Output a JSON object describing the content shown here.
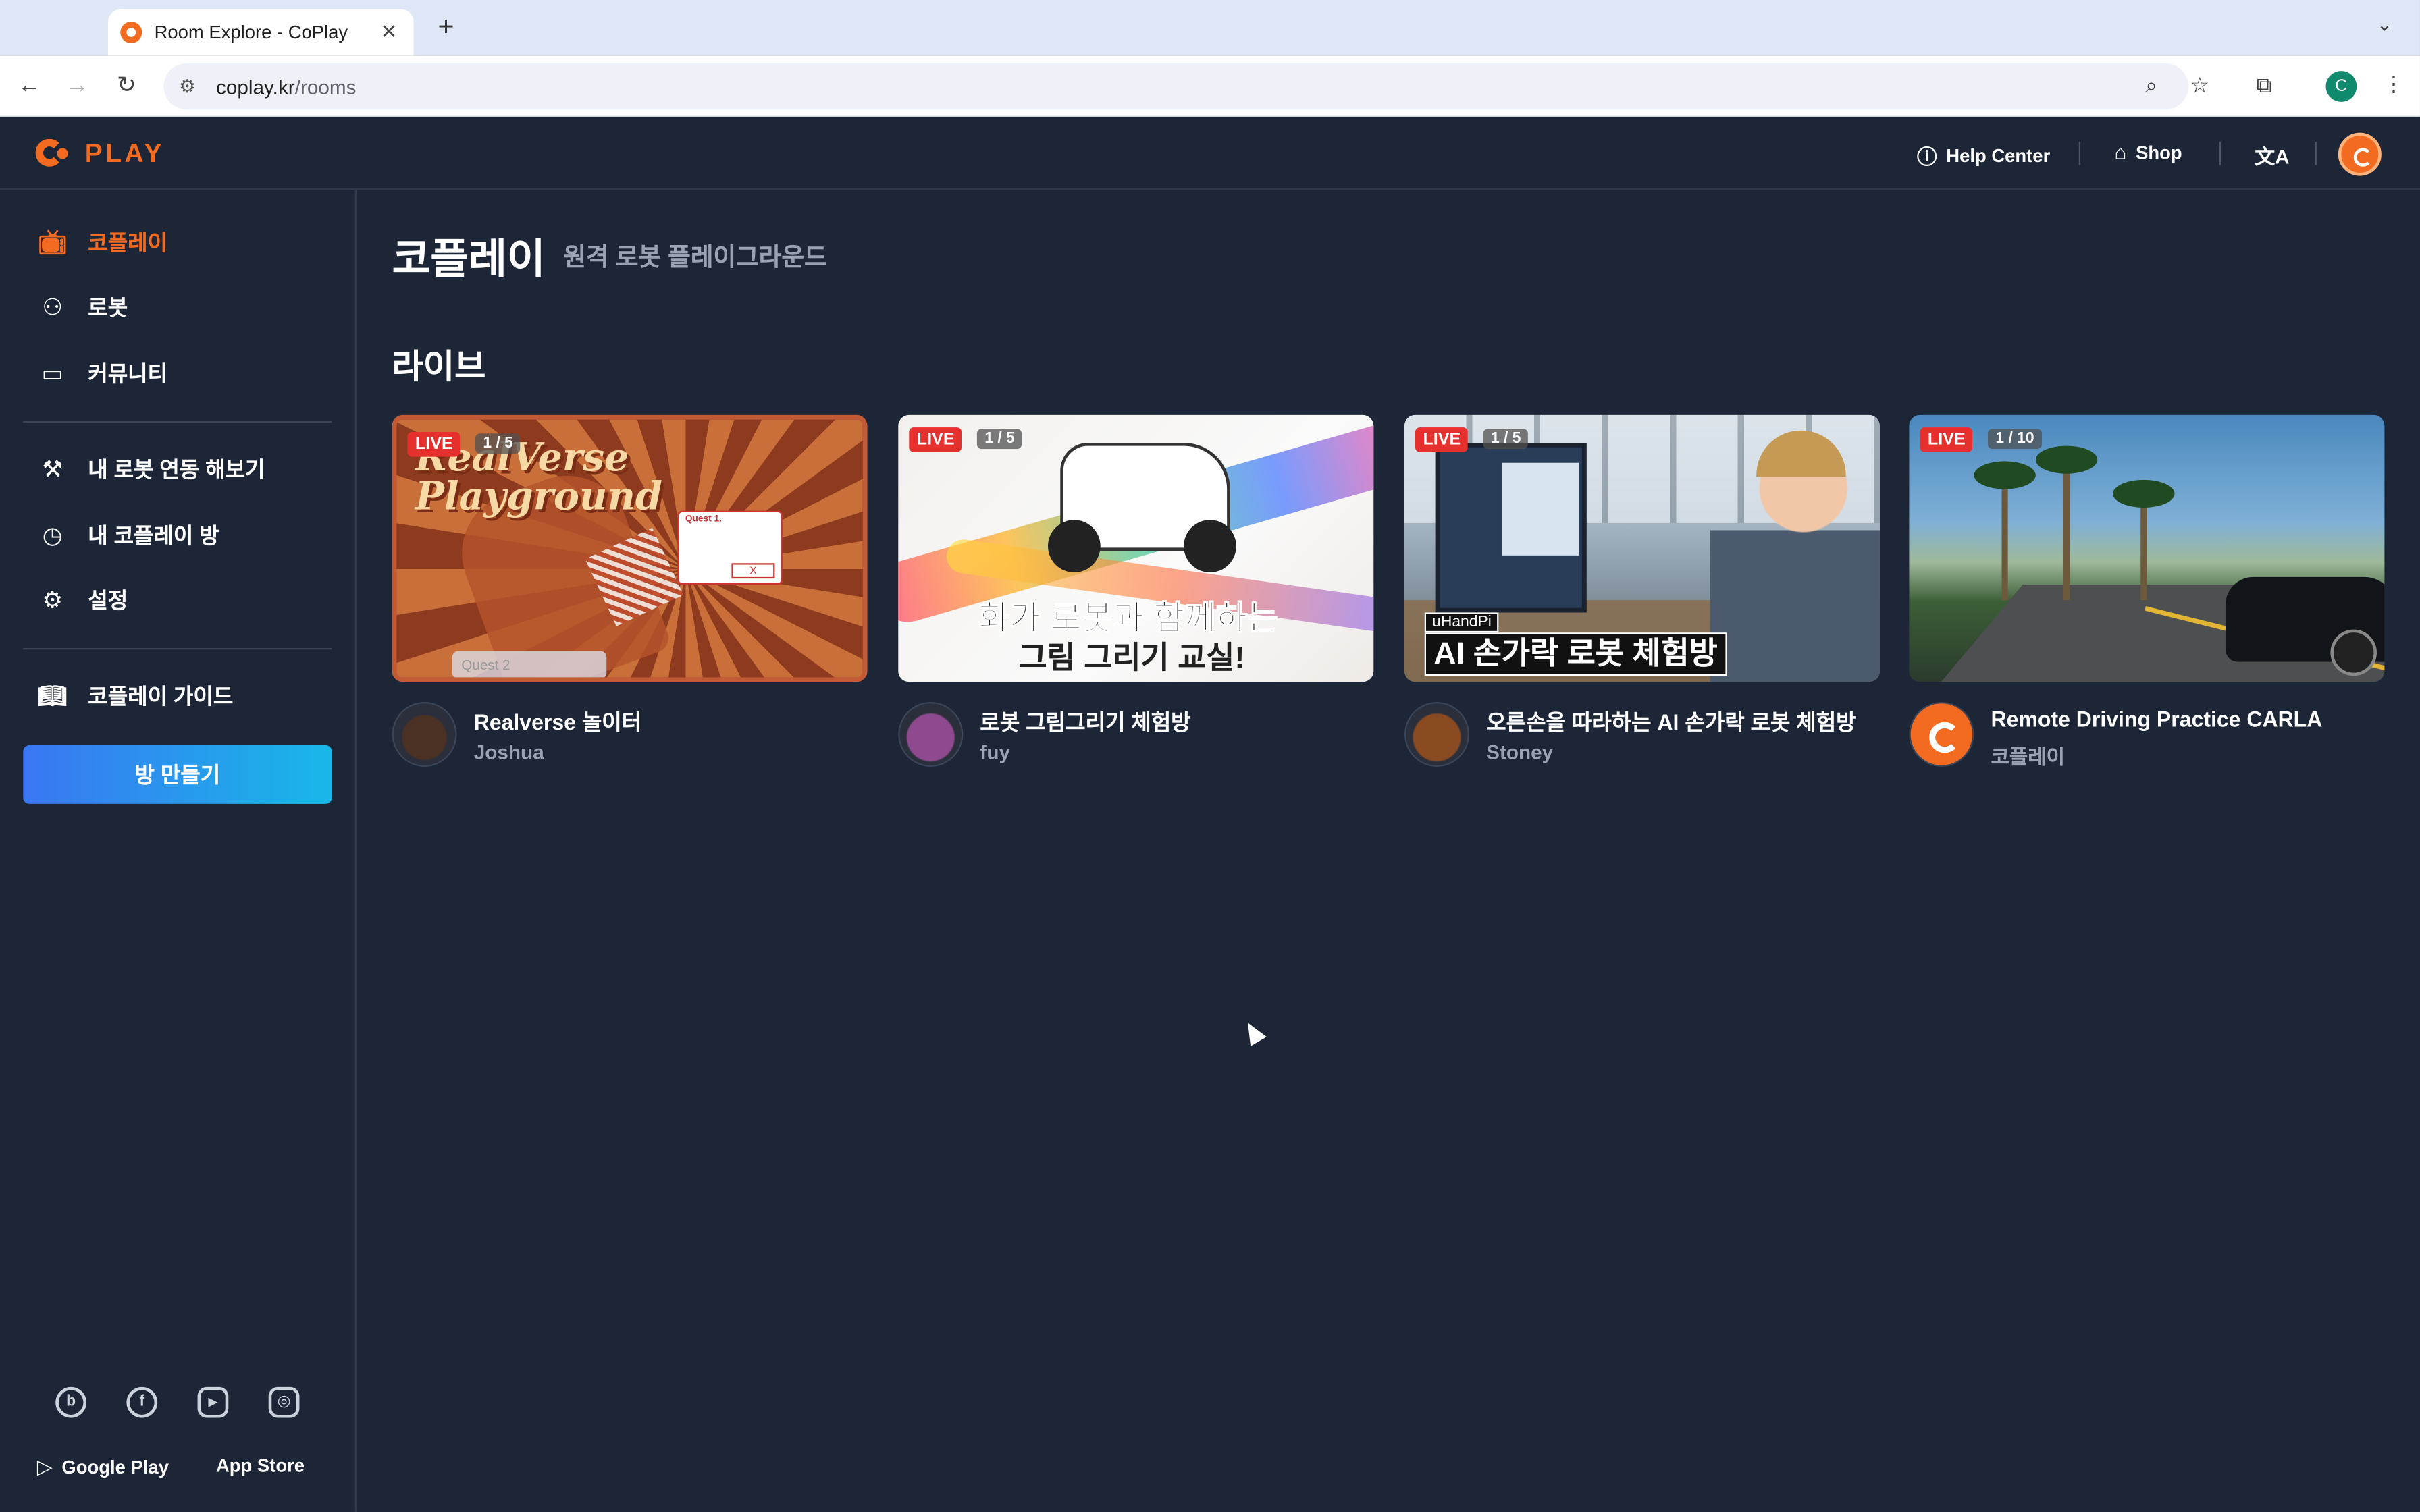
{
  "browser": {
    "tab_title": "Room Explore - CoPlay",
    "tab_close": "✕",
    "new_tab": "+",
    "tab_menu": "⌄",
    "url_domain": "coplay.kr",
    "url_path": "/rooms",
    "profile_initial": "C"
  },
  "header": {
    "logo_text": "PLAY",
    "help_center": "Help Center",
    "shop": "Shop",
    "translate_glyph": "文A"
  },
  "sidebar": {
    "items": [
      {
        "label": "코플레이",
        "icon": "tv-icon"
      },
      {
        "label": "로봇",
        "icon": "robot-icon"
      },
      {
        "label": "커뮤니티",
        "icon": "chat-icon"
      },
      {
        "label": "내 로봇 연동 해보기",
        "icon": "tools-icon"
      },
      {
        "label": "내 코플레이 방",
        "icon": "play-circle-icon"
      },
      {
        "label": "설정",
        "icon": "gear-icon"
      },
      {
        "label": "코플레이 가이드",
        "icon": "book-icon"
      }
    ],
    "create_room": "방 만들기",
    "socials": [
      "blog-icon",
      "facebook-icon",
      "youtube-icon",
      "instagram-icon"
    ],
    "social_glyphs": [
      "b",
      "f",
      "▶",
      "◎"
    ],
    "google_play": "Google Play",
    "app_store": "App Store"
  },
  "main": {
    "title": "코플레이",
    "subtitle": "원격 로봇 플레이그라운드",
    "section_live": "라이브"
  },
  "rooms": [
    {
      "title": "Realverse 놀이터",
      "owner": "Joshua",
      "live": "LIVE",
      "count": "1 / 5",
      "art_title_1": "RealVerse",
      "art_title_2": "Playground",
      "art_quest": "Quest 1.",
      "art_x": "X",
      "art_quest2": "Quest 2"
    },
    {
      "title": "로봇 그림그리기 체험방",
      "owner": "fuy",
      "live": "LIVE",
      "count": "1 / 5",
      "art_line_1": "화가 로봇과 함께하는",
      "art_line_2": "그림 그리기 교실!"
    },
    {
      "title": "오른손을 따라하는 AI 손가락 로봇 체험방",
      "owner": "Stoney",
      "live": "LIVE",
      "count": "1 / 5",
      "art_label_1": "uHandPi",
      "art_label_2": "AI 손가락 로봇 체험방"
    },
    {
      "title": "Remote Driving Practice CARLA",
      "owner": "코플레이",
      "live": "LIVE",
      "count": "1 / 10"
    }
  ],
  "colors": {
    "accent": "#f26b21",
    "background": "#1d2637",
    "live_badge": "#e5302d",
    "button_gradient_start": "#3a76f2",
    "button_gradient_end": "#18b8e8"
  }
}
